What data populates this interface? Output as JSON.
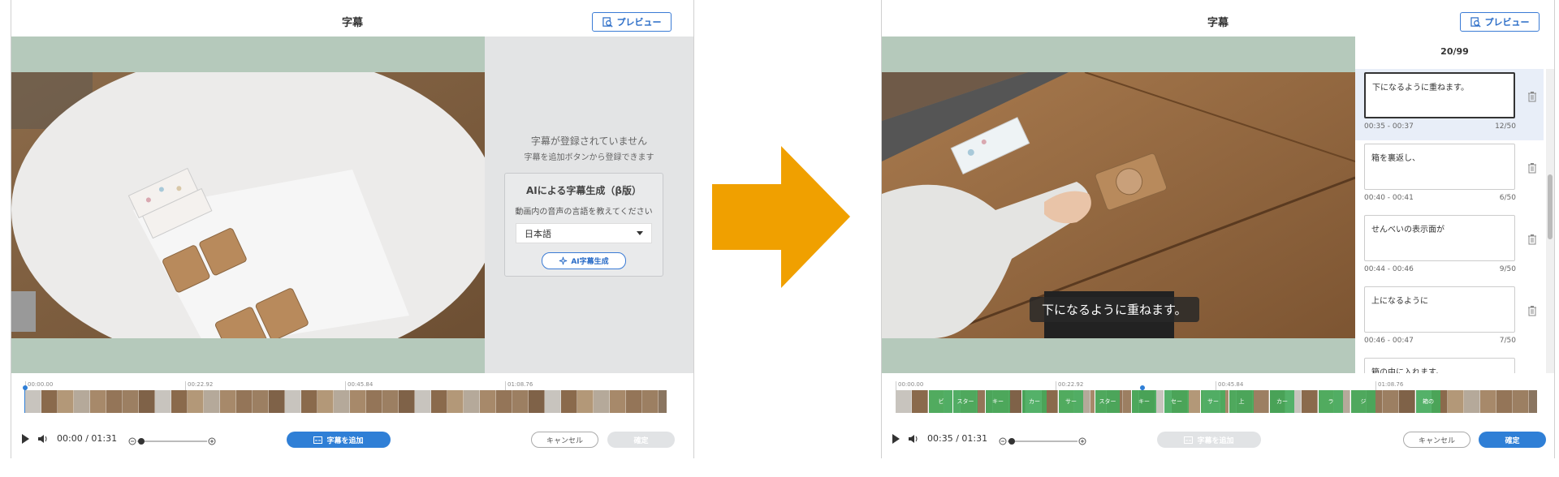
{
  "left": {
    "title": "字幕",
    "preview_label": "プレビュー",
    "empty_message": "字幕が登録されていません",
    "empty_hint": "字幕を追加ボタンから登録できます",
    "ai_title": "AIによる字幕生成（β版）",
    "ai_sub": "動画内の音声の言語を教えてください",
    "language": "日本語",
    "ai_button": "AI字幕生成",
    "time": "00:00 / 01:31",
    "add_subtitle": "字幕を追加",
    "cancel": "キャンセル",
    "confirm": "確定",
    "ticks": [
      "00:00.00",
      "00:22.92",
      "00:45.84",
      "01:08.76"
    ]
  },
  "right": {
    "title": "字幕",
    "preview_label": "プレビュー",
    "counter": "20/99",
    "caption": "下になるように重ねます。",
    "time": "00:35 / 01:31",
    "add_subtitle": "字幕を追加",
    "cancel": "キャンセル",
    "confirm": "確定",
    "ticks": [
      "00:00.00",
      "00:22.92",
      "00:45.84",
      "01:08.76"
    ],
    "subtitles": [
      {
        "text": "下になるように重ねます。",
        "range": "00:35 - 00:37",
        "count": "12/50"
      },
      {
        "text": "箱を裏返し、",
        "range": "00:40 - 00:41",
        "count": "6/50"
      },
      {
        "text": "せんべいの表示面が",
        "range": "00:44 - 00:46",
        "count": "9/50"
      },
      {
        "text": "上になるように",
        "range": "00:46 - 00:47",
        "count": "7/50"
      },
      {
        "text": "箱の中に入れます。",
        "range": "",
        "count": ""
      }
    ],
    "segment_labels": [
      "ビ",
      "スター",
      "キー",
      "カー",
      "サー",
      "スター",
      "キー",
      "セー",
      "サー",
      "上",
      "カー",
      "ラ",
      "ジ",
      "箱の"
    ]
  },
  "colors": {
    "accent": "#2f7fd6",
    "arrow": "#f0a000",
    "stage_bg": "#b5c9bb",
    "segment_green": "#3fae5a"
  }
}
